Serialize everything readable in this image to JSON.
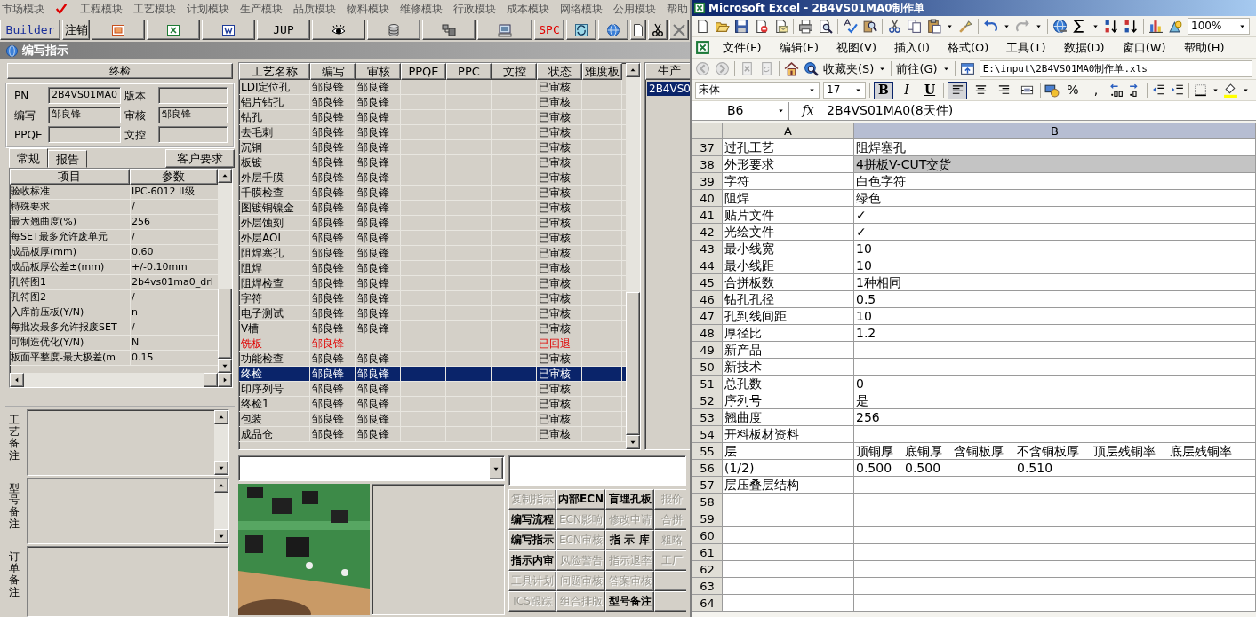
{
  "app": {
    "modules": [
      {
        "label": "市场模块",
        "checked": false
      },
      {
        "label": "工程模块",
        "checked": true
      },
      {
        "label": "工艺模块",
        "checked": false
      },
      {
        "label": "计划模块",
        "checked": false
      },
      {
        "label": "生产模块",
        "checked": false
      },
      {
        "label": "品质模块",
        "checked": false
      },
      {
        "label": "物料模块",
        "checked": false
      },
      {
        "label": "维修模块",
        "checked": false
      },
      {
        "label": "行政模块",
        "checked": false
      },
      {
        "label": "成本模块",
        "checked": false
      },
      {
        "label": "网络模块",
        "checked": false
      },
      {
        "label": "公用模块",
        "checked": false
      },
      {
        "label": "帮助",
        "checked": false
      }
    ],
    "toolbar": {
      "builder": "Builder",
      "logout": "注销",
      "jup": "JUP",
      "spc": "SPC"
    },
    "window_title": "编写指示",
    "step_header": "终检",
    "form": [
      {
        "label": "PN",
        "value": "2B4VS01MA0"
      },
      {
        "label": "版本"
      },
      {
        "label": "编写",
        "value": "邹良锋"
      },
      {
        "label": "审核",
        "value": "邹良锋"
      },
      {
        "label": "PPQE"
      },
      {
        "label": "文控"
      }
    ],
    "tabs": [
      {
        "label": "常规",
        "selected": true
      },
      {
        "label": "报告",
        "selected": false
      }
    ],
    "customer_button": "客户要求",
    "params": {
      "columns": [
        "项目",
        "参数"
      ],
      "rows": [
        [
          "验收标准",
          "IPC-6012 II级"
        ],
        [
          "特殊要求",
          "/"
        ],
        [
          "最大翘曲度(%)",
          "256"
        ],
        [
          "每SET最多允许废单元",
          "/"
        ],
        [
          "成品板厚(mm)",
          "0.60"
        ],
        [
          "成品板厚公差±(mm)",
          "+/-0.10mm"
        ],
        [
          "孔符图1",
          "2b4vs01ma0_drl"
        ],
        [
          "孔符图2",
          "/"
        ],
        [
          "入库前压板(Y/N)",
          "n"
        ],
        [
          "每批次最多允许报废SET",
          "/"
        ],
        [
          "可制造优化(Y/N)",
          "N"
        ],
        [
          "板面平整度-最大极差(m",
          "0.15"
        ]
      ]
    },
    "remarks": [
      {
        "label": "工艺备注",
        "scrollbar": true
      },
      {
        "label": "型号备注",
        "scrollbar": true
      },
      {
        "label": "订单备注",
        "scrollbar": false
      }
    ],
    "process_table": {
      "columns": [
        "工艺名称",
        "编写",
        "审核",
        "PPQE",
        "PPC",
        "文控",
        "状态",
        "难度板"
      ],
      "rows": [
        {
          "name": "LDI定位孔",
          "writer": "邹良锋",
          "reviewer": "邹良锋",
          "status": "已审核",
          "returned": false,
          "selected": false
        },
        {
          "name": "铝片钻孔",
          "writer": "邹良锋",
          "reviewer": "邹良锋",
          "status": "已审核",
          "returned": false,
          "selected": false
        },
        {
          "name": "钻孔",
          "writer": "邹良锋",
          "reviewer": "邹良锋",
          "status": "已审核",
          "returned": false,
          "selected": false
        },
        {
          "name": "去毛刺",
          "writer": "邹良锋",
          "reviewer": "邹良锋",
          "status": "已审核",
          "returned": false,
          "selected": false
        },
        {
          "name": "沉铜",
          "writer": "邹良锋",
          "reviewer": "邹良锋",
          "status": "已审核",
          "returned": false,
          "selected": false
        },
        {
          "name": "板镀",
          "writer": "邹良锋",
          "reviewer": "邹良锋",
          "status": "已审核",
          "returned": false,
          "selected": false
        },
        {
          "name": "外层千膜",
          "writer": "邹良锋",
          "reviewer": "邹良锋",
          "status": "已审核",
          "returned": false,
          "selected": false
        },
        {
          "name": "千膜检查",
          "writer": "邹良锋",
          "reviewer": "邹良锋",
          "status": "已审核",
          "returned": false,
          "selected": false
        },
        {
          "name": "图镀铜镍金",
          "writer": "邹良锋",
          "reviewer": "邹良锋",
          "status": "已审核",
          "returned": false,
          "selected": false
        },
        {
          "name": "外层蚀刻",
          "writer": "邹良锋",
          "reviewer": "邹良锋",
          "status": "已审核",
          "returned": false,
          "selected": false
        },
        {
          "name": "外层AOI",
          "writer": "邹良锋",
          "reviewer": "邹良锋",
          "status": "已审核",
          "returned": false,
          "selected": false
        },
        {
          "name": "阻焊塞孔",
          "writer": "邹良锋",
          "reviewer": "邹良锋",
          "status": "已审核",
          "returned": false,
          "selected": false
        },
        {
          "name": "阻焊",
          "writer": "邹良锋",
          "reviewer": "邹良锋",
          "status": "已审核",
          "returned": false,
          "selected": false
        },
        {
          "name": "阻焊检查",
          "writer": "邹良锋",
          "reviewer": "邹良锋",
          "status": "已审核",
          "returned": false,
          "selected": false
        },
        {
          "name": "字符",
          "writer": "邹良锋",
          "reviewer": "邹良锋",
          "status": "已审核",
          "returned": false,
          "selected": false
        },
        {
          "name": "电子测试",
          "writer": "邹良锋",
          "reviewer": "邹良锋",
          "status": "已审核",
          "returned": false,
          "selected": false
        },
        {
          "name": "V槽",
          "writer": "邹良锋",
          "reviewer": "邹良锋",
          "status": "已审核",
          "returned": false,
          "selected": false
        },
        {
          "name": "铣板",
          "writer": "邹良锋",
          "status": "已回退",
          "returned": true,
          "selected": false
        },
        {
          "name": "功能检查",
          "writer": "邹良锋",
          "reviewer": "邹良锋",
          "status": "已审核",
          "returned": false,
          "selected": false
        },
        {
          "name": "终检",
          "writer": "邹良锋",
          "reviewer": "邹良锋",
          "status": "已审核",
          "returned": false,
          "selected": true
        },
        {
          "name": "印序列号",
          "writer": "邹良锋",
          "reviewer": "邹良锋",
          "status": "已审核",
          "returned": false,
          "selected": false
        },
        {
          "name": "终检1",
          "writer": "邹良锋",
          "reviewer": "邹良锋",
          "status": "已审核",
          "returned": false,
          "selected": false
        },
        {
          "name": "包装",
          "writer": "邹良锋",
          "reviewer": "邹良锋",
          "status": "已审核",
          "returned": false,
          "selected": false
        },
        {
          "name": "成品仓",
          "writer": "邹良锋",
          "reviewer": "邹良锋",
          "status": "已审核",
          "returned": false,
          "selected": false
        }
      ]
    },
    "side_list": {
      "header": "生产",
      "items": [
        {
          "label": "2B4VS0",
          "selected": true
        }
      ]
    },
    "actions": [
      {
        "label": "复制指示",
        "enabled": false
      },
      {
        "label": "内部ECN",
        "enabled": true
      },
      {
        "label": "盲埋孔板",
        "enabled": true
      },
      {
        "label": "报价",
        "enabled": false
      },
      {
        "label": "编写流程",
        "enabled": true
      },
      {
        "label": "ECN影响",
        "enabled": false
      },
      {
        "label": "修改申请",
        "enabled": false
      },
      {
        "label": "合拼",
        "enabled": false
      },
      {
        "label": "编写指示",
        "enabled": true
      },
      {
        "label": "ECN审核",
        "enabled": false
      },
      {
        "label": "指 示 库",
        "enabled": true
      },
      {
        "label": "粗略",
        "enabled": false
      },
      {
        "label": "指示内审",
        "enabled": true
      },
      {
        "label": "风险警告",
        "enabled": false
      },
      {
        "label": "指示退率",
        "enabled": false
      },
      {
        "label": "工厂",
        "enabled": false
      },
      {
        "label": "工具计划",
        "enabled": false
      },
      {
        "label": "问题审核",
        "enabled": false
      },
      {
        "label": "答案审核",
        "enabled": false
      },
      {
        "kind": "blank"
      },
      {
        "label": "ICS跟踪",
        "enabled": false
      },
      {
        "label": "组合排版",
        "enabled": false
      },
      {
        "label": "型号备注",
        "enabled": true
      },
      {
        "kind": "blank"
      }
    ]
  },
  "excel": {
    "title": "Microsoft Excel - 2B4VS01MA0制作单",
    "zoom": "100%",
    "menu": [
      "文件(F)",
      "编辑(E)",
      "视图(V)",
      "插入(I)",
      "格式(O)",
      "工具(T)",
      "数据(D)",
      "窗口(W)",
      "帮助(H)"
    ],
    "web": {
      "favorites": "收藏夹(S)",
      "go": "前往(G)",
      "address": "E:\\input\\2B4VS01MA0制作单.xls"
    },
    "format": {
      "font": "宋体",
      "size": "17",
      "styles": [
        {
          "label": "B",
          "pressed": true
        },
        {
          "label": "I",
          "pressed": false
        },
        {
          "label": "U",
          "pressed": false
        }
      ],
      "align": [
        {
          "kind": "left",
          "pressed": true
        },
        {
          "kind": "center",
          "pressed": false
        },
        {
          "kind": "right",
          "pressed": false
        },
        {
          "kind": "merge",
          "pressed": false
        }
      ],
      "percent": "%",
      "comma": ","
    },
    "name_box": "B6",
    "fx": "fx",
    "formula": "2B4VS01MA0(8天件)",
    "columns": [
      {
        "label": "A",
        "selected": false
      },
      {
        "label": "B",
        "selected": true
      }
    ],
    "rows": [
      {
        "n": "37",
        "a": "过孔工艺",
        "b": [
          "阻焊塞孔"
        ],
        "highlighted": false
      },
      {
        "n": "38",
        "a": "外形要求",
        "b": [
          "4拼板V-CUT交货"
        ],
        "highlighted": true
      },
      {
        "n": "39",
        "a": "字符",
        "b": [
          "白色字符"
        ],
        "highlighted": false
      },
      {
        "n": "40",
        "a": "阻焊",
        "b": [
          "绿色"
        ],
        "highlighted": false
      },
      {
        "n": "41",
        "a": "贴片文件",
        "b": [
          "✓"
        ],
        "highlighted": false
      },
      {
        "n": "42",
        "a": "光绘文件",
        "b": [
          "✓"
        ],
        "highlighted": false
      },
      {
        "n": "43",
        "a": "最小线宽",
        "b": [
          "10"
        ],
        "highlighted": false
      },
      {
        "n": "44",
        "a": "最小线距",
        "b": [
          "10"
        ],
        "highlighted": false
      },
      {
        "n": "45",
        "a": "合拼板数",
        "b": [
          "1种相同"
        ],
        "highlighted": false
      },
      {
        "n": "46",
        "a": "钻孔孔径",
        "b": [
          "0.5"
        ],
        "highlighted": false
      },
      {
        "n": "47",
        "a": "孔到线间距",
        "b": [
          "10"
        ],
        "highlighted": false
      },
      {
        "n": "48",
        "a": "厚径比",
        "b": [
          "1.2"
        ],
        "highlighted": false
      },
      {
        "n": "49",
        "a": "新产品",
        "highlighted": false
      },
      {
        "n": "50",
        "a": "新技术",
        "highlighted": false
      },
      {
        "n": "51",
        "a": "总孔数",
        "b": [
          "0"
        ],
        "highlighted": false
      },
      {
        "n": "52",
        "a": "序列号",
        "b": [
          "是"
        ],
        "highlighted": false
      },
      {
        "n": "53",
        "a": "翘曲度",
        "b": [
          "256"
        ],
        "highlighted": false
      },
      {
        "n": "54",
        "a": "开料板材资料",
        "highlighted": false
      },
      {
        "n": "55",
        "a": "层",
        "b": [
          "顶铜厚",
          "底铜厚",
          "含铜板厚",
          "不含铜板厚",
          "顶层残铜率",
          "底层残铜率"
        ],
        "highlighted": false
      },
      {
        "n": "56",
        "a": "(1/2)",
        "b": [
          {
            "text": "0.500"
          },
          {
            "text": "0.500"
          },
          {
            "text": "0.510",
            "after_gap": true
          }
        ],
        "highlighted": false
      },
      {
        "n": "57",
        "a": "层压叠层结构",
        "highlighted": false
      },
      {
        "n": "58",
        "highlighted": false
      },
      {
        "n": "59",
        "highlighted": false
      },
      {
        "n": "60",
        "highlighted": false
      },
      {
        "n": "61",
        "highlighted": false
      },
      {
        "n": "62",
        "highlighted": false
      },
      {
        "n": "63",
        "highlighted": false
      },
      {
        "n": "64",
        "highlighted": false
      }
    ]
  }
}
